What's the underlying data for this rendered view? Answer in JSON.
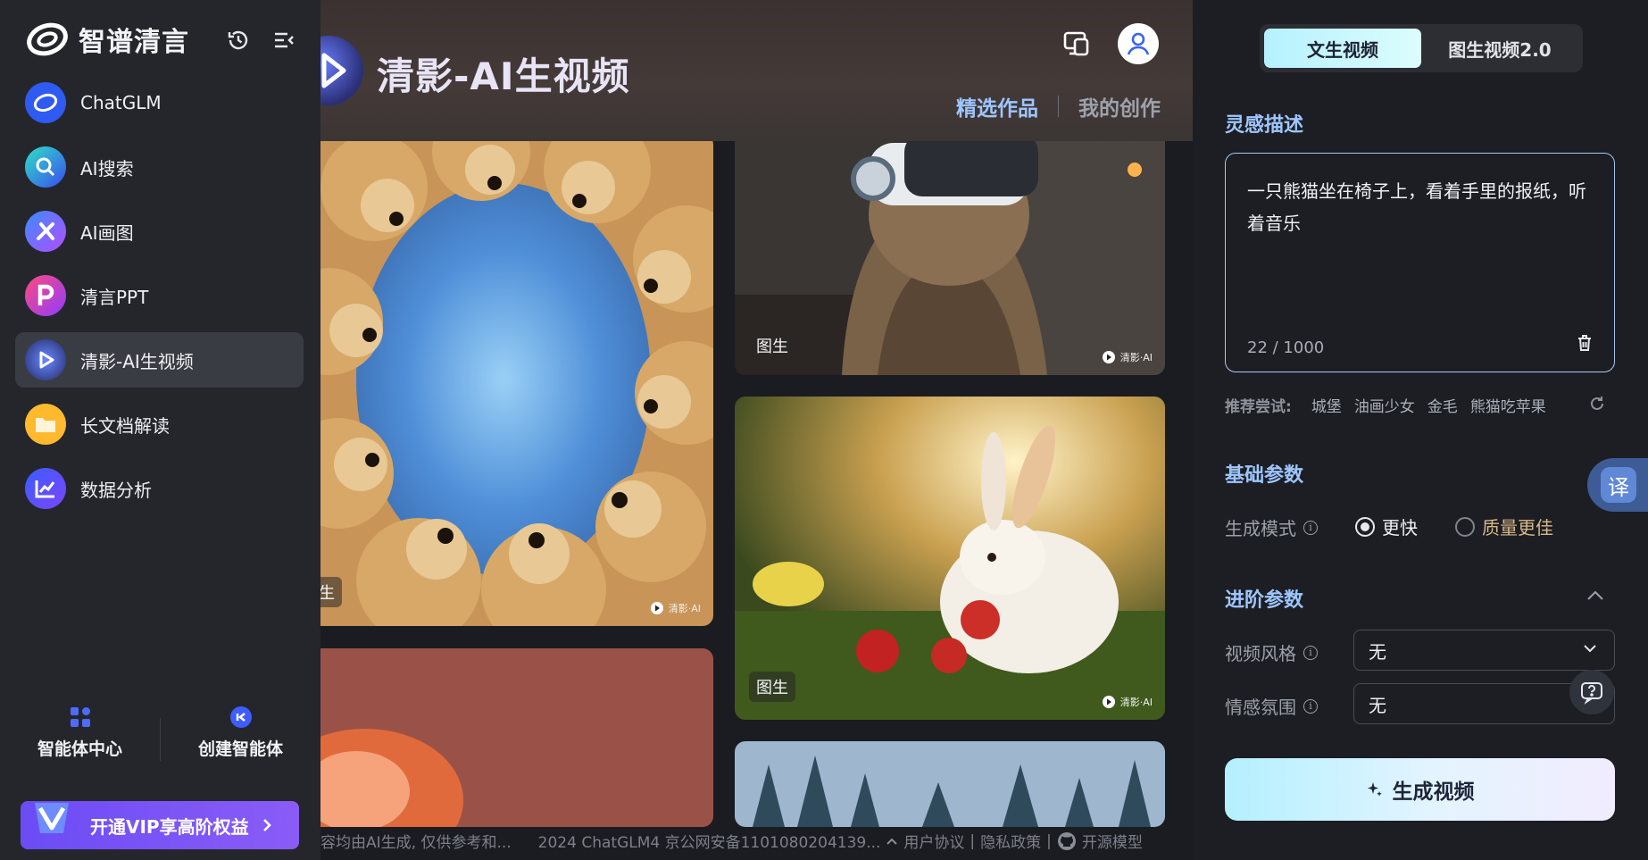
{
  "brand": {
    "name": "智谱清言"
  },
  "sidebar": {
    "items": [
      {
        "label": "ChatGLM"
      },
      {
        "label": "AI搜索"
      },
      {
        "label": "AI画图"
      },
      {
        "label": "清言PPT"
      },
      {
        "label": "清影-AI生视频"
      },
      {
        "label": "长文档解读"
      },
      {
        "label": "数据分析"
      }
    ],
    "active_index": 4,
    "tools": {
      "agent_center": "智能体中心",
      "create_agent": "创建智能体"
    },
    "vip_label": "开通VIP享高阶权益"
  },
  "gallery": {
    "title": "清影-AI生视频",
    "tabs": {
      "featured": "精选作品",
      "mine": "我的创作"
    },
    "cards": [
      {
        "tag": "生",
        "watermark": "清影·AI"
      },
      {
        "tag": "图生",
        "watermark": "清影·AI"
      },
      {
        "tag": "图生",
        "watermark": "清影·AI"
      }
    ],
    "footer": {
      "disclaimer": "容均由AI生成, 仅供参考和...",
      "copyright": "2024 ChatGLM4 京公网安备1101080204139...",
      "terms": "用户协议",
      "privacy": "隐私政策",
      "open_source": "开源模型"
    }
  },
  "panel": {
    "modes": {
      "text_to_video": "文生视频",
      "image_to_video": "图生视频2.0"
    },
    "inspiration_title": "灵感描述",
    "prompt_text": "一只熊猫坐在椅子上，看着手里的报纸，听着音乐",
    "prompt_count": "22 / 1000",
    "suggest_label": "推荐尝试:",
    "suggestions": [
      "城堡",
      "油画少女",
      "金毛",
      "熊猫吃苹果"
    ],
    "basic_title": "基础参数",
    "gen_mode_label": "生成模式",
    "gen_mode_options": {
      "fast": "更快",
      "quality": "质量更佳"
    },
    "advanced_title": "进阶参数",
    "style_label": "视频风格",
    "style_value": "无",
    "mood_label": "情感氛围",
    "mood_value": "无",
    "generate_label": "生成视频",
    "translate_label": "译"
  }
}
